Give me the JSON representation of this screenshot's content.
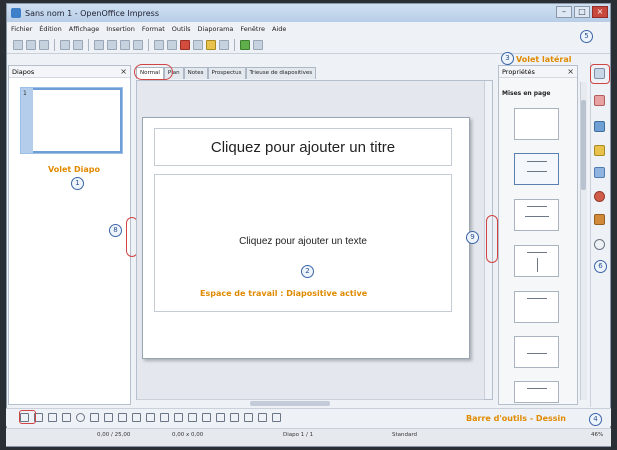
{
  "window": {
    "title": "Sans nom 1 - OpenOffice Impress"
  },
  "menubar": [
    "Fichier",
    "Édition",
    "Affichage",
    "Insertion",
    "Format",
    "Outils",
    "Diaporama",
    "Fenêtre",
    "Aide"
  ],
  "slides_pane": {
    "title": "Diapos",
    "close": "×",
    "slide_number": "1"
  },
  "tabs": [
    "Normal",
    "Plan",
    "Notes",
    "Prospectus",
    "Trieuse de diapositives"
  ],
  "slide": {
    "title_placeholder": "Cliquez pour ajouter un titre",
    "content_placeholder": "Cliquez pour ajouter un texte"
  },
  "properties_pane": {
    "title": "Propriétés",
    "close": "×",
    "section": "Mises en page"
  },
  "annotations": {
    "slides_pane_label": "Volet Diapo",
    "workspace_label": "Espace de travail : Diapositive active",
    "sidebar_label": "Volet latéral",
    "drawing_toolbar_label": "Barre d'outils - Dessin",
    "markers": [
      "1",
      "2",
      "3",
      "4",
      "5",
      "6",
      "7",
      "8",
      "9"
    ]
  },
  "statusbar": {
    "position": "0,00 / 25,00",
    "size": "0,00 x 0,00",
    "slide_info": "Diapo 1 / 1",
    "layout": "Standard",
    "zoom": "46%"
  },
  "colors": {
    "annotation_orange": "#e08a00",
    "highlight_red": "#d04444",
    "marker_blue": "#3a64a8"
  }
}
